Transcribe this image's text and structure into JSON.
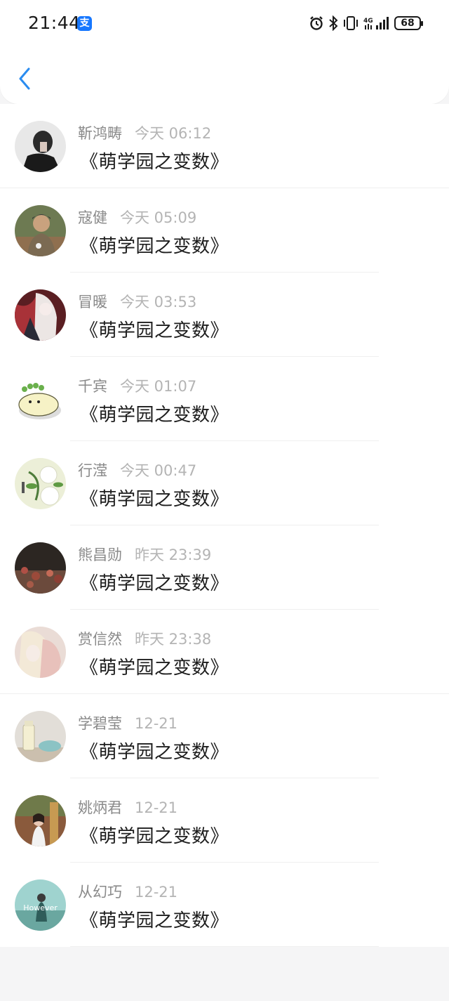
{
  "status_bar": {
    "time": "21:44",
    "app_badge": "支",
    "network": "4G",
    "battery": "68"
  },
  "header": {
    "back_icon": "chevron-left-icon"
  },
  "items": [
    {
      "name": "靳鸿畴",
      "time": "今天 06:12",
      "message": "《萌学园之变数》"
    },
    {
      "name": "寇健",
      "time": "今天 05:09",
      "message": "《萌学园之变数》"
    },
    {
      "name": "冒暖",
      "time": "今天 03:53",
      "message": "《萌学园之变数》"
    },
    {
      "name": "千宾",
      "time": "今天 01:07",
      "message": "《萌学园之变数》"
    },
    {
      "name": "行滢",
      "time": "今天 00:47",
      "message": "《萌学园之变数》"
    },
    {
      "name": "熊昌勋",
      "time": "昨天 23:39",
      "message": "《萌学园之变数》"
    },
    {
      "name": "赏信然",
      "time": "昨天 23:38",
      "message": "《萌学园之变数》"
    },
    {
      "name": "学碧莹",
      "time": "12-21",
      "message": "《萌学园之变数》"
    },
    {
      "name": "姚炳君",
      "time": "12-21",
      "message": "《萌学园之变数》"
    },
    {
      "name": "从幻巧",
      "time": "12-21",
      "message": "《萌学园之变数》"
    }
  ],
  "avatar_text": {
    "item_10": "However"
  },
  "colors": {
    "accent": "#2a8cf0",
    "name": "#8a8a8a",
    "timestamp": "#b4b4b4",
    "message": "#1d1d1d",
    "background": "#f5f5f6"
  }
}
